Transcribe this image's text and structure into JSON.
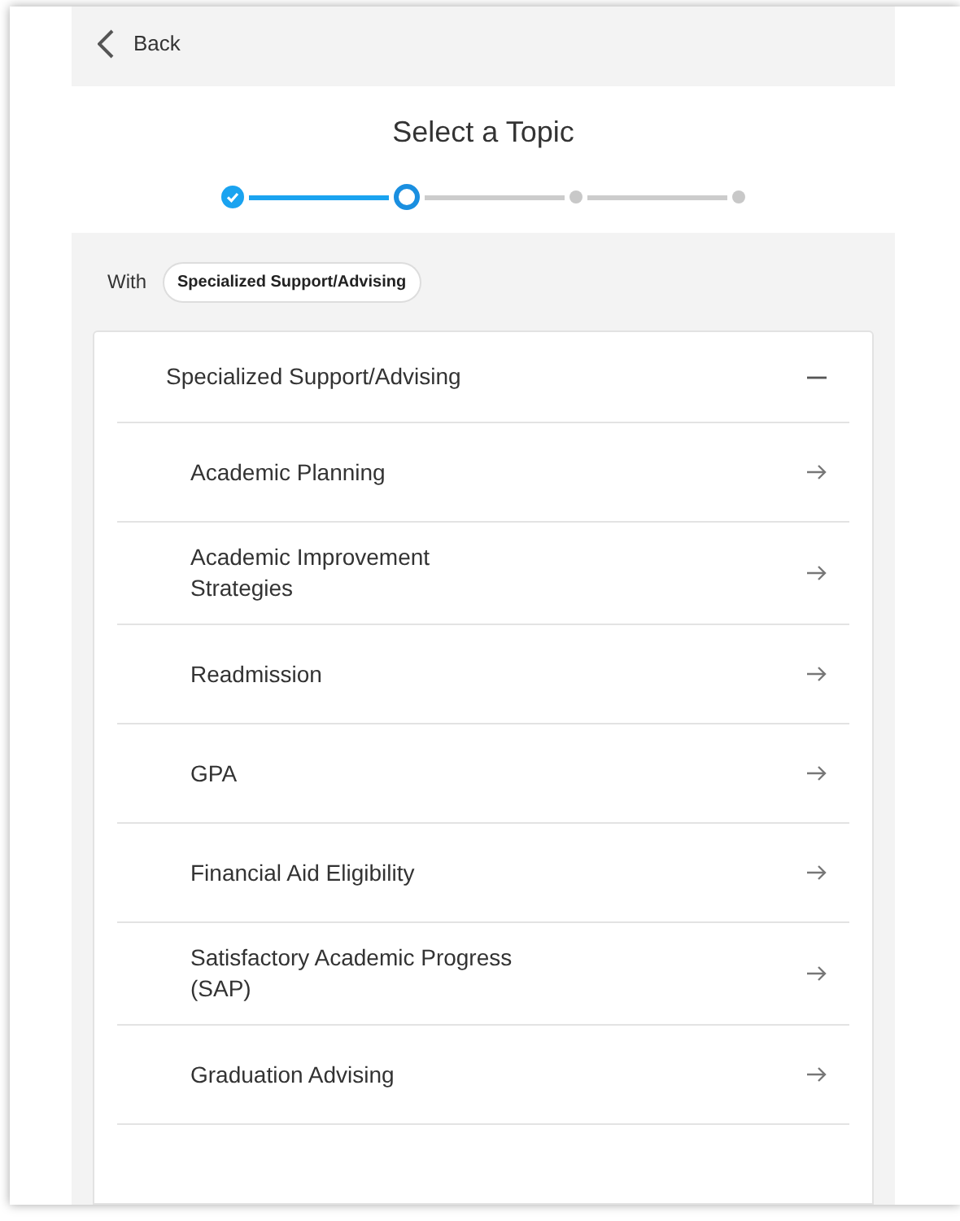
{
  "back": {
    "label": "Back"
  },
  "title": "Select a Topic",
  "steps": [
    {
      "done": true,
      "current": false
    },
    {
      "done": false,
      "current": true
    },
    {
      "done": false,
      "current": false
    },
    {
      "done": false,
      "current": false
    }
  ],
  "with": {
    "label": "With",
    "chip": "Specialized Support/Advising"
  },
  "group": {
    "title": "Specialized Support/Advising",
    "expanded": true,
    "items": [
      {
        "label": "Academic Planning"
      },
      {
        "label": "Academic Improvement Strategies"
      },
      {
        "label": "Readmission"
      },
      {
        "label": "GPA"
      },
      {
        "label": "Financial Aid Eligibility"
      },
      {
        "label": "Satisfactory Academic Progress (SAP)"
      },
      {
        "label": "Graduation Advising"
      }
    ]
  }
}
